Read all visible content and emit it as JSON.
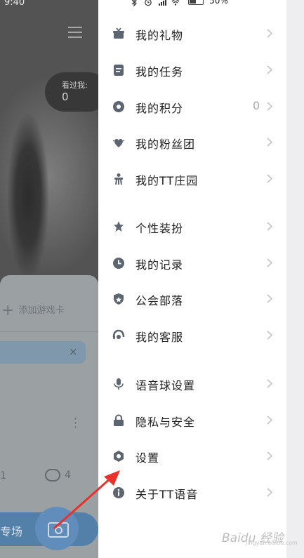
{
  "status_bar": {
    "battery": "50%"
  },
  "background_app": {
    "time": "9:40",
    "visitors_label": "看过我:",
    "visitors_count": "0",
    "add_game_card": "添加游戏卡",
    "chip_close": "×",
    "like_count": "1",
    "comment_count": "4",
    "zone_label": "专场"
  },
  "drawer": {
    "items": [
      {
        "label": "我的礼物",
        "icon": "gift-icon",
        "value": ""
      },
      {
        "label": "我的任务",
        "icon": "task-icon",
        "value": ""
      },
      {
        "label": "我的积分",
        "icon": "points-icon",
        "value": "0"
      },
      {
        "label": "我的粉丝团",
        "icon": "fan-club-icon",
        "value": ""
      },
      {
        "label": "我的TT庄园",
        "icon": "manor-icon",
        "value": ""
      },
      {
        "label": "个性装扮",
        "icon": "dress-up-icon",
        "value": ""
      },
      {
        "label": "我的记录",
        "icon": "history-icon",
        "value": ""
      },
      {
        "label": "公会部落",
        "icon": "guild-icon",
        "value": ""
      },
      {
        "label": "我的客服",
        "icon": "customer-service-icon",
        "value": ""
      },
      {
        "label": "语音球设置",
        "icon": "voice-ball-icon",
        "value": ""
      },
      {
        "label": "隐私与安全",
        "icon": "lock-icon",
        "value": ""
      },
      {
        "label": "设置",
        "icon": "settings-icon",
        "value": ""
      },
      {
        "label": "关于TT语音",
        "icon": "info-icon",
        "value": ""
      }
    ]
  },
  "watermark": {
    "text": "Baidu 经验",
    "sub": "jingyan.baidu.com"
  },
  "colors": {
    "icon": "#5d6670",
    "chevron": "#c2c2c8",
    "annotation_arrow": "#e8322c"
  }
}
